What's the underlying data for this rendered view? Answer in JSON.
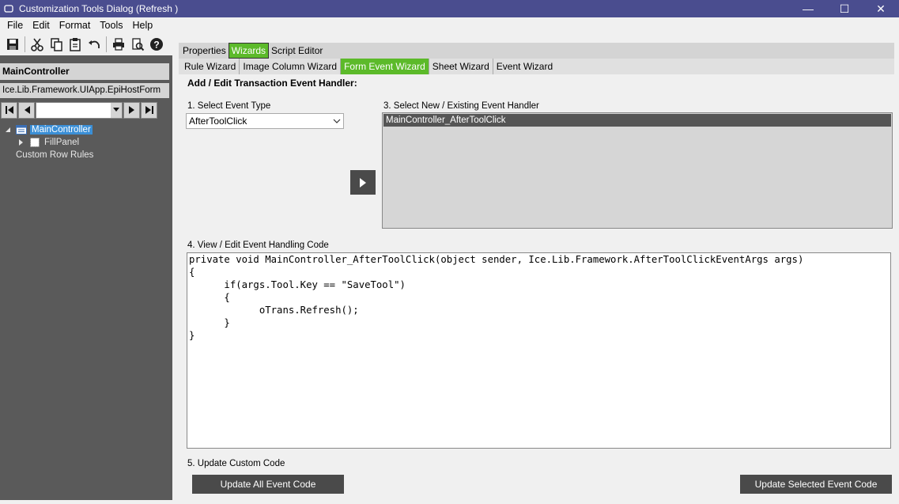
{
  "window": {
    "title": "Customization Tools Dialog  (Refresh )",
    "min_glyph": "—",
    "max_glyph": "☐",
    "close_glyph": "✕"
  },
  "menu": {
    "items": [
      {
        "label": "File"
      },
      {
        "label": "Edit"
      },
      {
        "label": "Format"
      },
      {
        "label": "Tools"
      },
      {
        "label": "Help"
      }
    ]
  },
  "toolbar": {
    "icons": [
      "save-icon",
      "cut-icon",
      "copy-icon",
      "paste-icon",
      "undo-icon",
      "print-icon",
      "print-preview-icon",
      "help-icon"
    ]
  },
  "left_panel": {
    "header": "MainController",
    "path": "Ice.Lib.Framework.UIApp.EpiHostForm",
    "tree": [
      {
        "label": "MainController"
      },
      {
        "label": "FillPanel"
      },
      {
        "label": "Custom Row Rules"
      }
    ]
  },
  "tabs_main": [
    {
      "label": "Properties",
      "active": false
    },
    {
      "label": "Wizards",
      "active": true
    },
    {
      "label": "Script Editor",
      "active": false
    }
  ],
  "tabs_wizard": [
    {
      "label": "Rule Wizard",
      "active": false
    },
    {
      "label": "Image Column Wizard",
      "active": false
    },
    {
      "label": "Form Event Wizard",
      "active": true
    },
    {
      "label": "Sheet Wizard",
      "active": false
    },
    {
      "label": "Event Wizard",
      "active": false
    }
  ],
  "form": {
    "section_title": "Add / Edit Transaction Event Handler:",
    "step1_label": "1. Select Event Type",
    "event_type_value": "AfterToolClick",
    "step3_label": "3. Select New / Existing Event Handler",
    "handler_item": "MainController_AfterToolClick",
    "step4_label": "4. View / Edit Event Handling Code",
    "code_lines": [
      "private void MainController_AfterToolClick(object sender, Ice.Lib.Framework.AfterToolClickEventArgs args)",
      "{",
      "      if(args.Tool.Key == \"SaveTool\")",
      "      {",
      "            oTrans.Refresh();",
      "      }",
      "}"
    ],
    "step5_label": "5. Update Custom Code",
    "update_all_label": "Update All Event Code",
    "update_selected_label": "Update Selected Event Code"
  },
  "colors": {
    "titlebar": "#4a4d8f",
    "active_tab": "#5cba2a",
    "left_panel": "#5a5a5a",
    "dark_button": "#4a4a4a"
  }
}
